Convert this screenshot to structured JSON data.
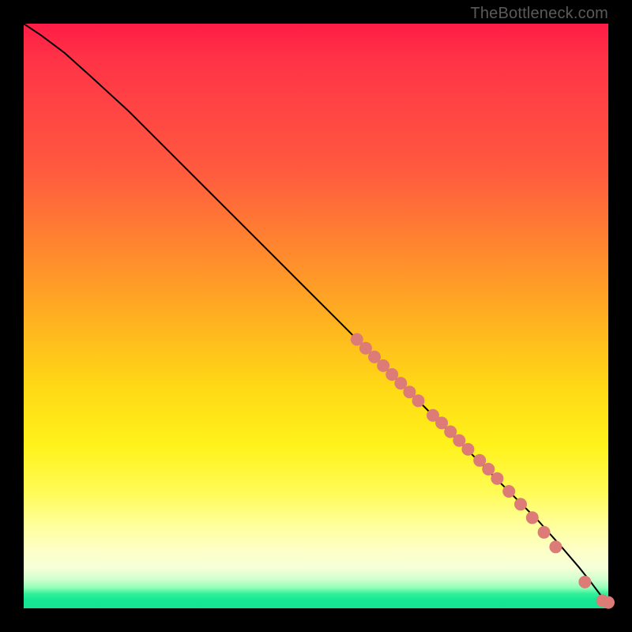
{
  "watermark": "TheBottleneck.com",
  "colors": {
    "point": "#dd7b76",
    "line": "#000000"
  },
  "chart_data": {
    "type": "line",
    "title": "",
    "xlabel": "",
    "ylabel": "",
    "xlim": [
      0,
      100
    ],
    "ylim": [
      0,
      100
    ],
    "grid": false,
    "legend": false,
    "series": [
      {
        "name": "curve",
        "x": [
          0,
          3,
          7,
          12,
          18,
          25,
          33,
          42,
          52,
          60,
          68,
          75,
          82,
          88,
          92,
          95,
          97,
          98.5,
          99.5,
          100
        ],
        "y": [
          100,
          98,
          95,
          90.5,
          85,
          78,
          70,
          61,
          51,
          43,
          35,
          28,
          21,
          15,
          10.5,
          7,
          4.5,
          2.5,
          1.2,
          1
        ]
      }
    ],
    "points": [
      {
        "x": 57,
        "y": 46
      },
      {
        "x": 58.5,
        "y": 44.5
      },
      {
        "x": 60,
        "y": 43
      },
      {
        "x": 61.5,
        "y": 41.5
      },
      {
        "x": 63,
        "y": 40
      },
      {
        "x": 64.5,
        "y": 38.5
      },
      {
        "x": 66,
        "y": 37
      },
      {
        "x": 67.5,
        "y": 35.5
      },
      {
        "x": 70,
        "y": 33
      },
      {
        "x": 71.5,
        "y": 31.7
      },
      {
        "x": 73,
        "y": 30.2
      },
      {
        "x": 74.5,
        "y": 28.7
      },
      {
        "x": 76,
        "y": 27.2
      },
      {
        "x": 78,
        "y": 25.3
      },
      {
        "x": 79.5,
        "y": 23.8
      },
      {
        "x": 81,
        "y": 22.2
      },
      {
        "x": 83,
        "y": 20
      },
      {
        "x": 85,
        "y": 17.8
      },
      {
        "x": 87,
        "y": 15.5
      },
      {
        "x": 89,
        "y": 13
      },
      {
        "x": 91,
        "y": 10.5
      },
      {
        "x": 96,
        "y": 4.5
      },
      {
        "x": 99,
        "y": 1.3
      },
      {
        "x": 100,
        "y": 1
      }
    ],
    "point_radius": 8
  }
}
